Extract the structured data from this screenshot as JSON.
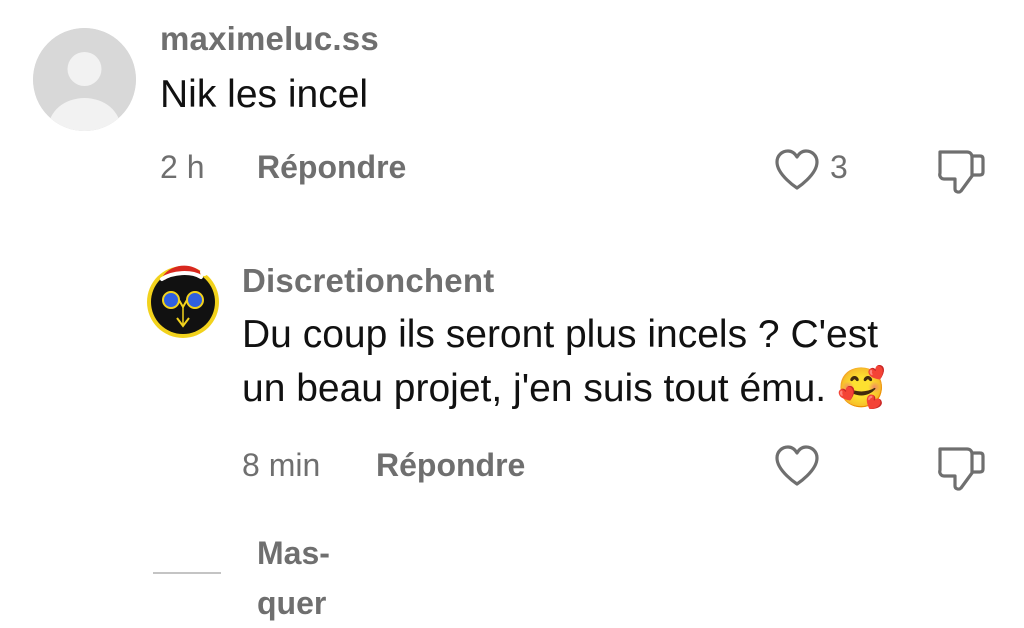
{
  "comments": [
    {
      "username": "maximeluc.ss",
      "text": "Nik les incel",
      "time": "2 h",
      "reply_label": "Répondre",
      "like_count": "3"
    },
    {
      "username": "Discretionchent",
      "text_line1": "Du coup ils seront plus incels ? C'est",
      "text_line2": "un beau projet, j'en suis tout ému. 🥰",
      "time": "8 min",
      "reply_label": "Répondre",
      "like_count": ""
    }
  ],
  "hide_replies": {
    "line1": "Mas-",
    "line2": "quer"
  },
  "icons": {
    "like": "heart-outline-icon",
    "dislike": "thumbs-down-icon"
  },
  "colors": {
    "muted_text": "#6f6f6f",
    "body_text": "#111111",
    "avatar_placeholder": "#d8d8d8"
  }
}
